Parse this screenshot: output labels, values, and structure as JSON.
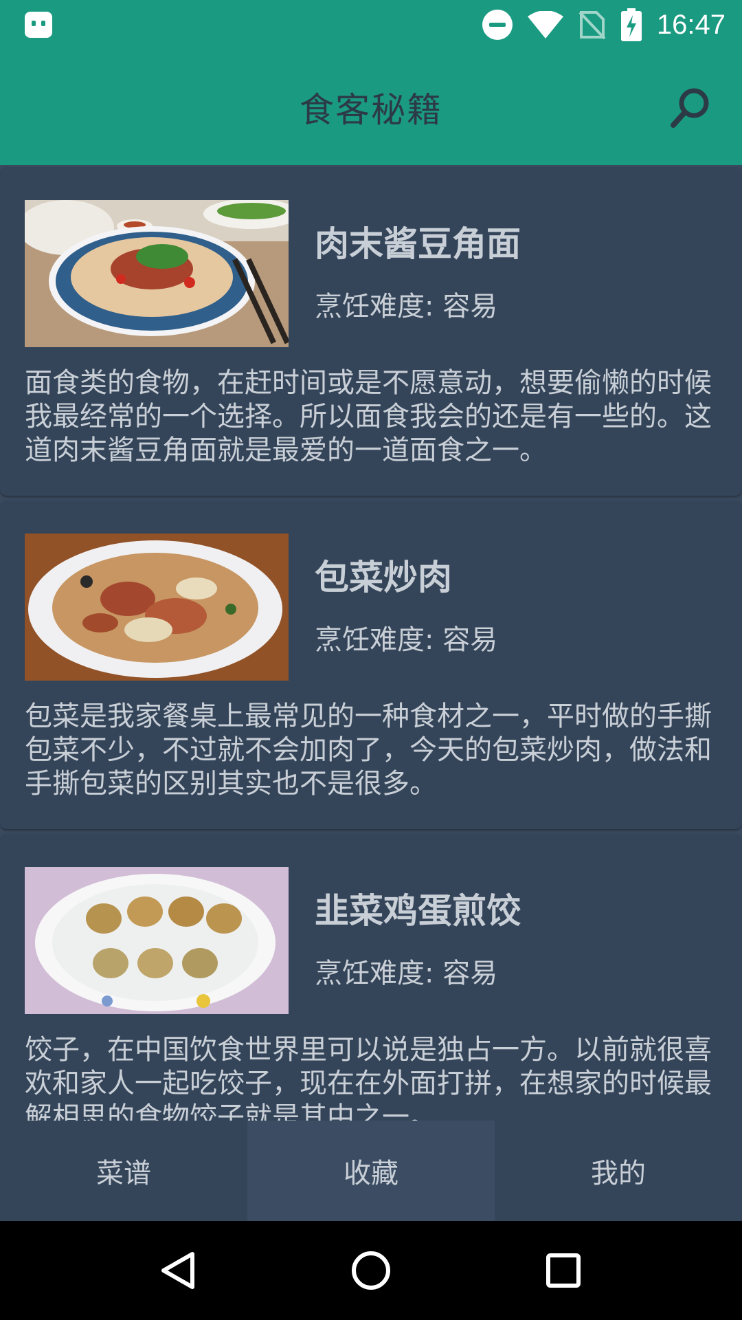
{
  "status_bar": {
    "time": "16:47",
    "icons": [
      "android-notification-icon",
      "do-not-disturb-icon",
      "wifi-icon",
      "no-sim-icon",
      "battery-charging-icon"
    ]
  },
  "app_bar": {
    "title": "食客秘籍",
    "search_icon": "search-icon"
  },
  "recipes": [
    {
      "title": "肉末酱豆角面",
      "difficulty": "烹饪难度: 容易",
      "description": "面食类的食物，在赶时间或是不愿意动，想要偷懒的时候我最经常的一个选择。所以面食我会的还是有一些的。这道肉末酱豆角面就是最爱的一道面食之一。",
      "image": "noodle-bowl-photo"
    },
    {
      "title": "包菜炒肉",
      "difficulty": "烹饪难度: 容易",
      "description": "包菜是我家餐桌上最常见的一种食材之一，平时做的手撕包菜不少，不过就不会加肉了，今天的包菜炒肉，做法和手撕包菜的区别其实也不是很多。",
      "image": "cabbage-pork-photo"
    },
    {
      "title": "韭菜鸡蛋煎饺",
      "difficulty": "烹饪难度: 容易",
      "description": "饺子，在中国饮食世界里可以说是独占一方。以前就很喜欢和家人一起吃饺子，现在在外面打拼，在想家的时候最解相思的食物饺子就是其中之一。",
      "image": "fried-dumplings-photo"
    }
  ],
  "tabs": [
    {
      "label": "菜谱",
      "selected": false
    },
    {
      "label": "收藏",
      "selected": true
    },
    {
      "label": "我的",
      "selected": false
    }
  ],
  "nav_bar": {
    "icons": [
      "back-icon",
      "home-icon",
      "recents-icon"
    ]
  },
  "colors": {
    "primary": "#1b9a82",
    "card": "#344459",
    "text": "#c9cfd6",
    "title": "#2c3a45"
  }
}
